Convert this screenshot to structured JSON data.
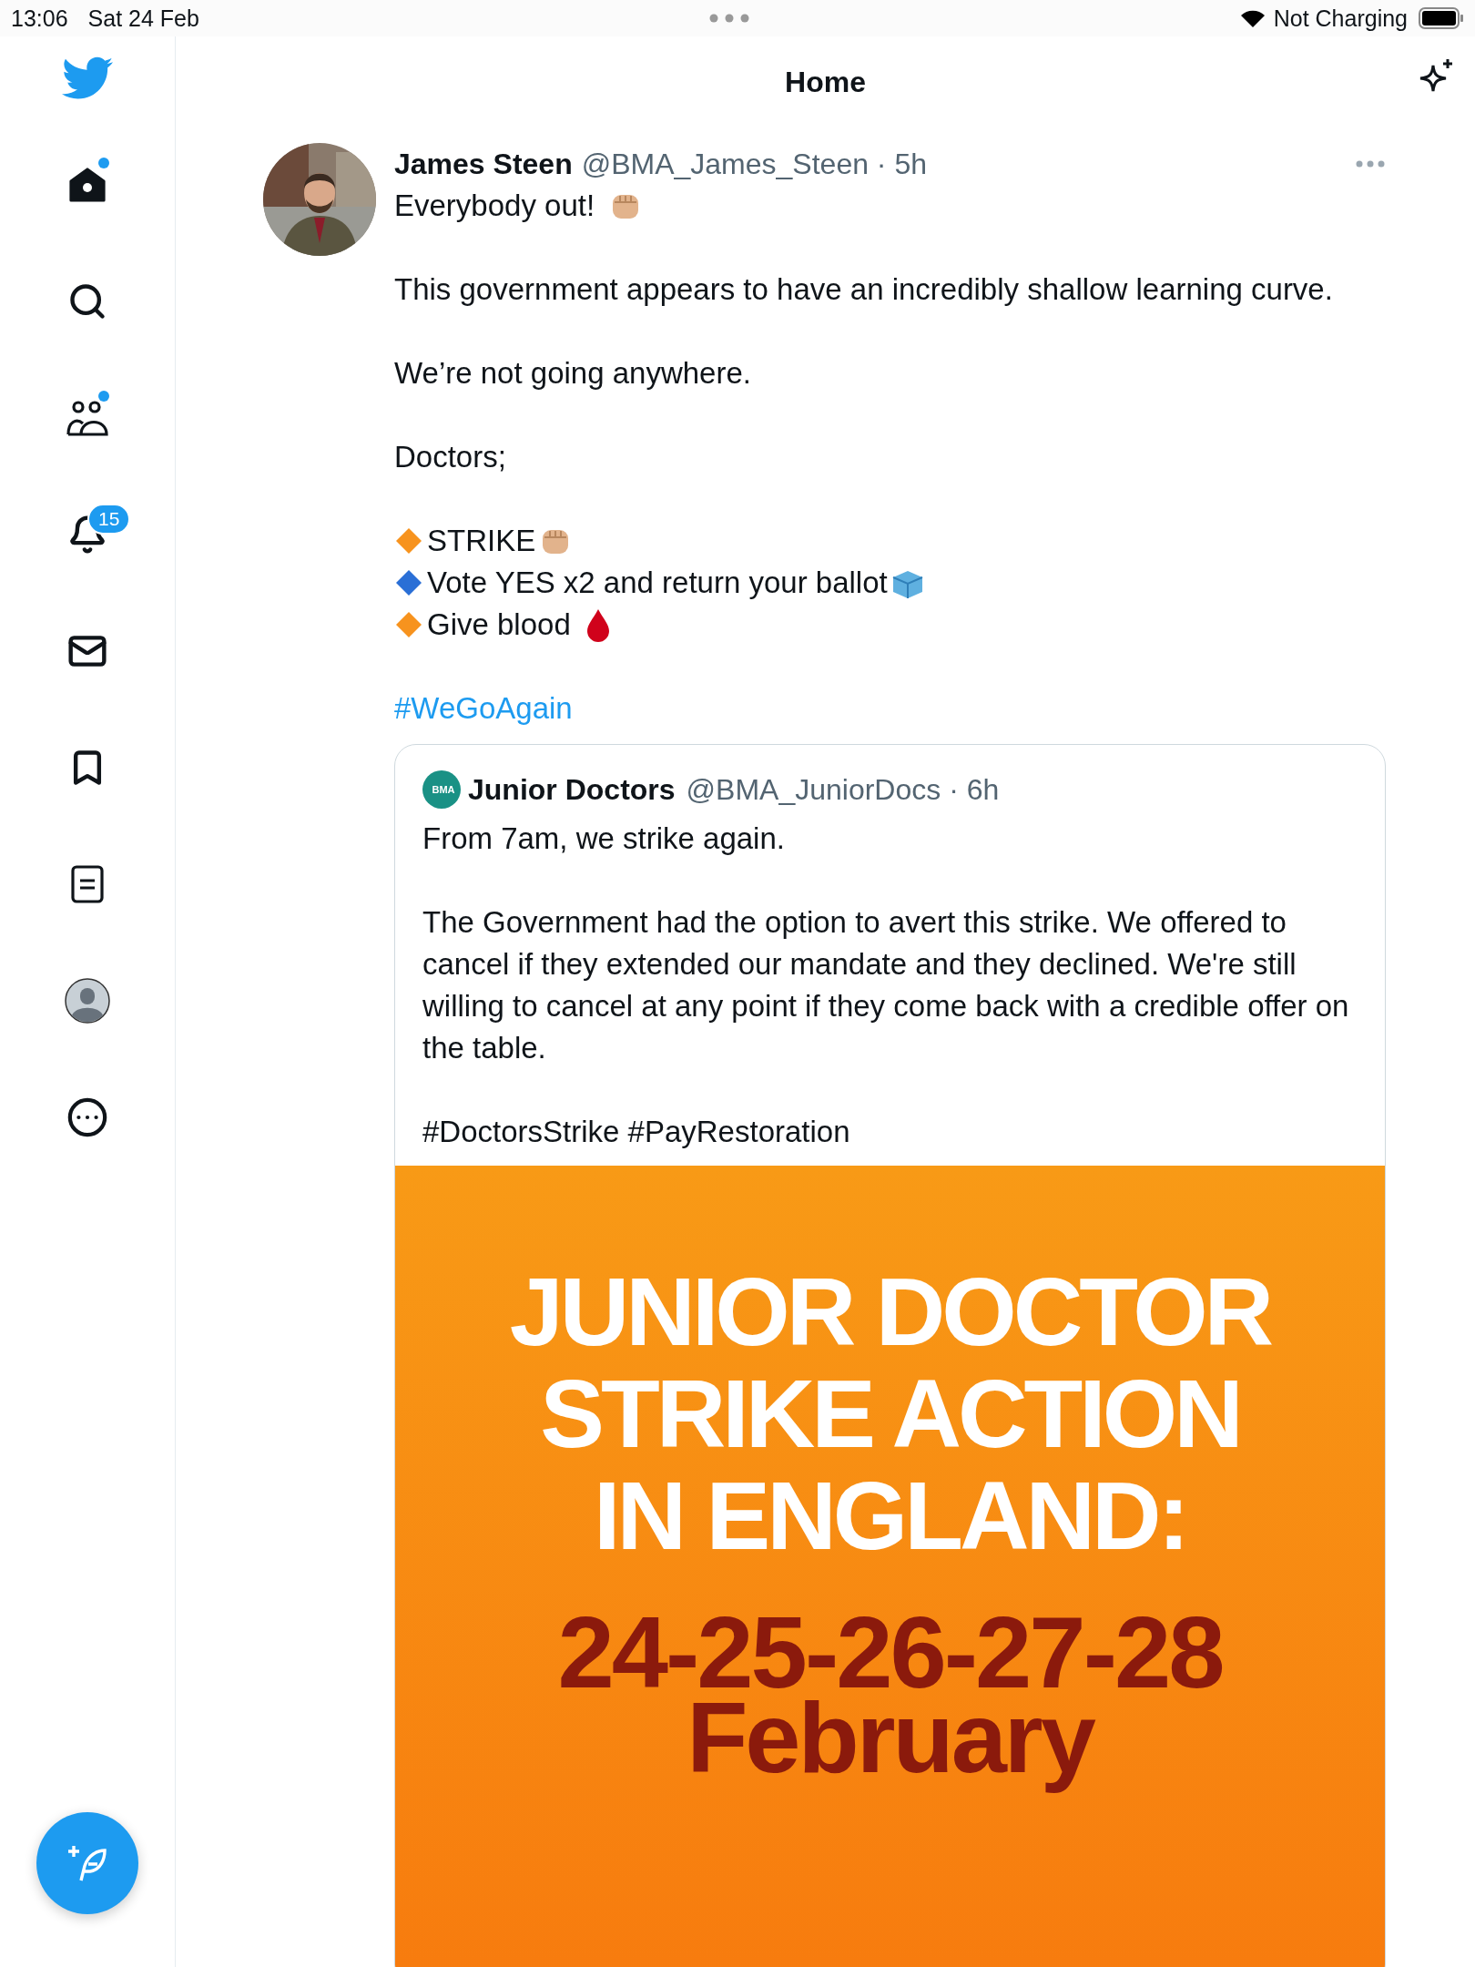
{
  "status_bar": {
    "time": "13:06",
    "date": "Sat 24 Feb",
    "charging": "Not Charging"
  },
  "sidebar": {
    "items": [
      {
        "kind": "home",
        "selected": true,
        "dot": true
      },
      {
        "kind": "search",
        "selected": false,
        "dot": false
      },
      {
        "kind": "communities",
        "selected": false,
        "dot": true
      },
      {
        "kind": "notifications",
        "selected": false,
        "dot": false,
        "badge": "15"
      },
      {
        "kind": "messages",
        "selected": false,
        "dot": false
      },
      {
        "kind": "bookmarks",
        "selected": false,
        "dot": false
      },
      {
        "kind": "lists",
        "selected": false,
        "dot": false
      },
      {
        "kind": "profile",
        "selected": false,
        "dot": false
      },
      {
        "kind": "more",
        "selected": false,
        "dot": false
      }
    ]
  },
  "header": {
    "title": "Home"
  },
  "tweet": {
    "name": "James Steen",
    "meta": "@BMA_James_Steen · 5h",
    "body": [
      {
        "kind": "fist-text",
        "text": "Everybody out!"
      },
      {
        "kind": "text",
        "text": "This government appears to have an incredibly shallow learning curve."
      },
      {
        "kind": "text",
        "text": "We’re not going anywhere."
      },
      {
        "kind": "text",
        "text": "Doctors;"
      },
      {
        "kind": "list",
        "items": [
          {
            "text": "STRIKE",
            "color": "#f7931e",
            "kind": "fist"
          },
          {
            "text": "Vote YES x2 and return your ballot",
            "color": "#2a6fd6",
            "kind": "ballot"
          },
          {
            "text": "Give blood",
            "color": "#f7931e",
            "kind": "blood"
          }
        ]
      },
      {
        "kind": "hashtag",
        "text": "#WeGoAgain"
      }
    ],
    "quote": {
      "avatar_text": "BMA",
      "name": "Junior Doctors",
      "meta": "@BMA_JuniorDocs · 6h",
      "paragraphs": [
        "From 7am, we strike again.",
        "The Government had the option to avert this strike. We offered to cancel if they extended our mandate and they declined. We're still willing to cancel at any point if they come back with a credible offer on the table.",
        "#DoctorsStrike #PayRestoration"
      ],
      "graphic": {
        "headline": [
          "JUNIOR DOCTOR",
          "STRIKE ACTION",
          "IN ENGLAND:"
        ],
        "dates": "24-25-26-27-28",
        "month": "February"
      }
    }
  }
}
